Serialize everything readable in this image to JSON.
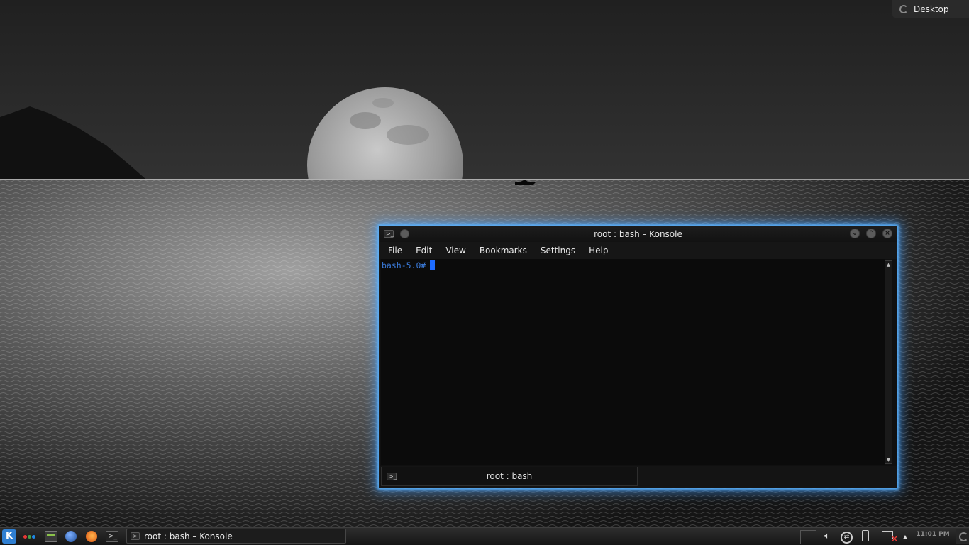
{
  "desktop": {
    "toolbox_label": "Desktop"
  },
  "window": {
    "title": "root : bash – Konsole",
    "menu": [
      "File",
      "Edit",
      "View",
      "Bookmarks",
      "Settings",
      "Help"
    ],
    "terminal": {
      "prompt": "bash-5.0#"
    },
    "tab": {
      "label": "root : bash"
    },
    "glow_color": "#5bb3ff"
  },
  "taskbar": {
    "task_label": "root : bash – Konsole",
    "clock": "11:01 PM",
    "quicklaunch_icons": [
      "kde-menu-icon",
      "app-dots-icon",
      "file-manager-icon",
      "globe-icon",
      "firefox-icon",
      "terminal-icon"
    ],
    "tray_icons": [
      "volume-icon",
      "network-icon",
      "battery-icon",
      "display-icon",
      "expand-arrow-icon"
    ]
  },
  "colors": {
    "prompt": "#3b7bdb",
    "cursor": "#1e6cff",
    "kde_blue": "#2f7fd2"
  }
}
